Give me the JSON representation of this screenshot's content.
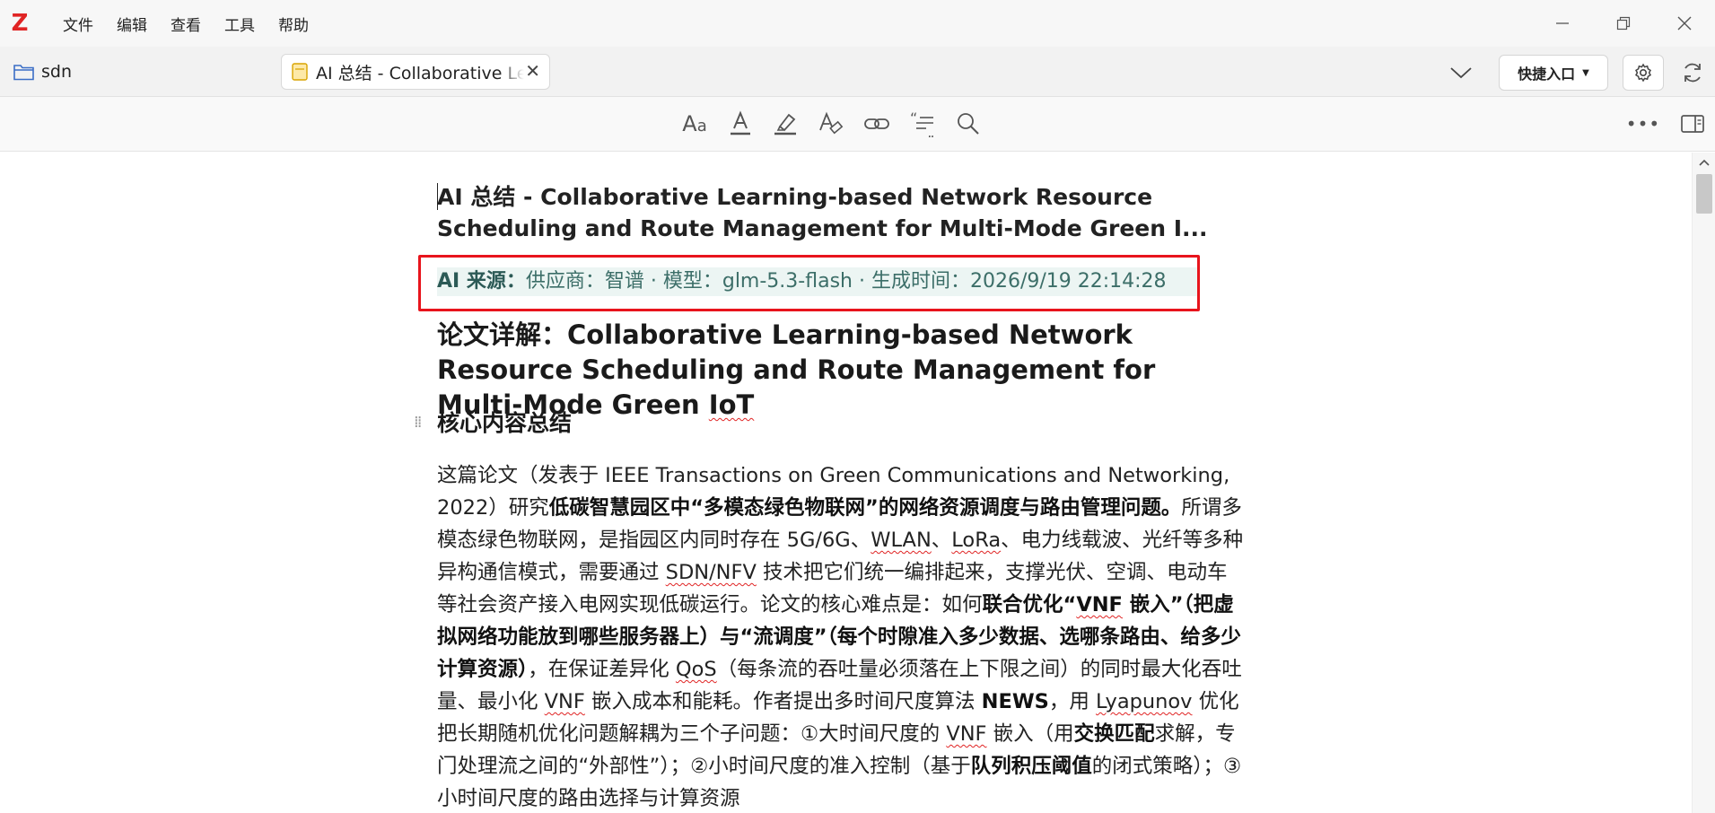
{
  "menubar": {
    "logo": "Z",
    "items": [
      "文件",
      "编辑",
      "查看",
      "工具",
      "帮助"
    ]
  },
  "tabbar": {
    "library_tab": "sdn",
    "doc_tab": "AI 总结 - Collaborative Learning-based Network Resource Scheduling",
    "quick_entry": "快捷入口"
  },
  "toolbar": {
    "icons": [
      "font-size-icon",
      "text-color-icon",
      "highlight-icon",
      "clear-format-icon",
      "link-icon",
      "citation-icon",
      "search-icon"
    ]
  },
  "note": {
    "title": "AI 总结 - Collaborative Learning-based Network Resource Scheduling and Route Management for Multi-Mode Green I...",
    "source_label": "AI 来源：",
    "source_text": "供应商：智谱 · 模型：glm-5.3-flash · 生成时间：2026/9/19 22:14:28",
    "heading1_prefix": "论文详解：",
    "heading1_text": "Collaborative Learning-based Network Resource Scheduling and Route Management for Multi-Mode Green ",
    "heading1_iot": "IoT",
    "heading2": "核心内容总结",
    "p": {
      "s1": "这篇论文（发表于 IEEE Transactions on Green Communications and Networking, 2022）研究",
      "b1": "低碳智慧园区中“多模态绿色物联网”的网络资源调度与路由管理问题。",
      "s2": "所谓多模态绿色物联网，是指园区内同时存在 5G/6G、",
      "w1": "WLAN",
      "s3": "、",
      "w2": "LoRa",
      "s4": "、电力线载波、光纤等多种异构通信模式，需要通过 ",
      "w3": "SDN/NFV",
      "s5": " 技术把它们统一编排起来，支撑光伏、空调、电动车等社会资产接入电网实现低碳运行。论文的核心难点是：如何",
      "b2a": "联合优化“",
      "w4": "VNF",
      "b2b": " 嵌入”（把虚拟网络功能放到哪些服务器上）与“流调度”（每个时隙准入多少数据、选哪条路由、给多少计算资源）",
      "s6": "，在保证差异化 ",
      "w5": "QoS",
      "s7": "（每条流的吞吐量必须落在上下限之间）的同时最大化吞吐量、最小化 ",
      "w6": "VNF",
      "s8": " 嵌入成本和能耗。作者提出多时间尺度算法 ",
      "b3": "NEWS",
      "s9": "，用 ",
      "w7": "Lyapunov",
      "s10": " 优化把长期随机优化问题解耦为三个子问题：①大时间尺度的 ",
      "w8": "VNF",
      "s11": " 嵌入（用",
      "b4": "交换匹配",
      "s12": "求解，专门处理流之间的“外部性”）；②小时间尺度的准入控制（基于",
      "b5": "队列积压阈值",
      "s13": "的闭式策略）；③小时间尺度的路由选择与计算资源"
    }
  }
}
